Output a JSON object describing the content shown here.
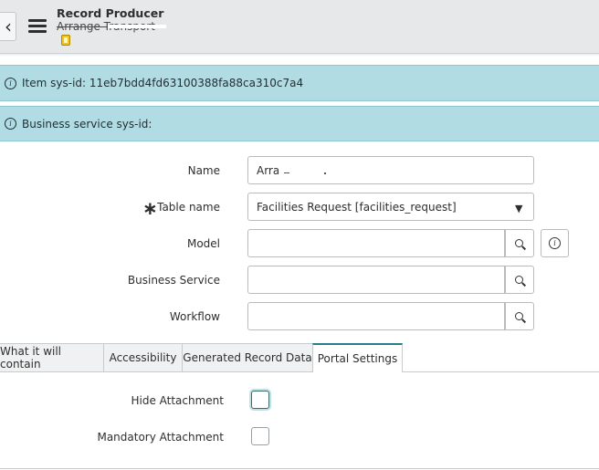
{
  "header": {
    "title": "Record Producer",
    "subtitle": "Arrange Transport",
    "back_glyph": "‹",
    "icons": [
      "chevron-left-icon",
      "hamburger-menu-icon",
      "record-icon"
    ]
  },
  "info_bars": {
    "item_sys_id": "Item sys-id: 11eb7bdd4fd63100388fa88ca310c7a4",
    "business_service_sys_id": "Business service sys-id:"
  },
  "form": {
    "name_label": "Name",
    "name_value": "Arra",
    "table_name_label": "Table name",
    "table_name_required_mark": "∗",
    "table_name_value": "Facilities Request [facilities_request]",
    "select_arrow": "▼",
    "model_label": "Model",
    "model_value": "",
    "business_service_label": "Business Service",
    "business_service_value": "",
    "workflow_label": "Workflow",
    "workflow_value": ""
  },
  "tabs": [
    {
      "label": "What it will contain",
      "active": false
    },
    {
      "label": "Accessibility",
      "active": false
    },
    {
      "label": "Generated Record Data",
      "active": false
    },
    {
      "label": "Portal Settings",
      "active": true
    }
  ],
  "portal_settings": {
    "hide_attachment_label": "Hide Attachment",
    "hide_attachment_checked": false,
    "mandatory_attachment_label": "Mandatory Attachment",
    "mandatory_attachment_checked": false
  },
  "colors": {
    "info_bar_bg": "#b2dce3",
    "header_bg": "#e6e8ea",
    "active_tab_accent": "#2b7a89"
  }
}
